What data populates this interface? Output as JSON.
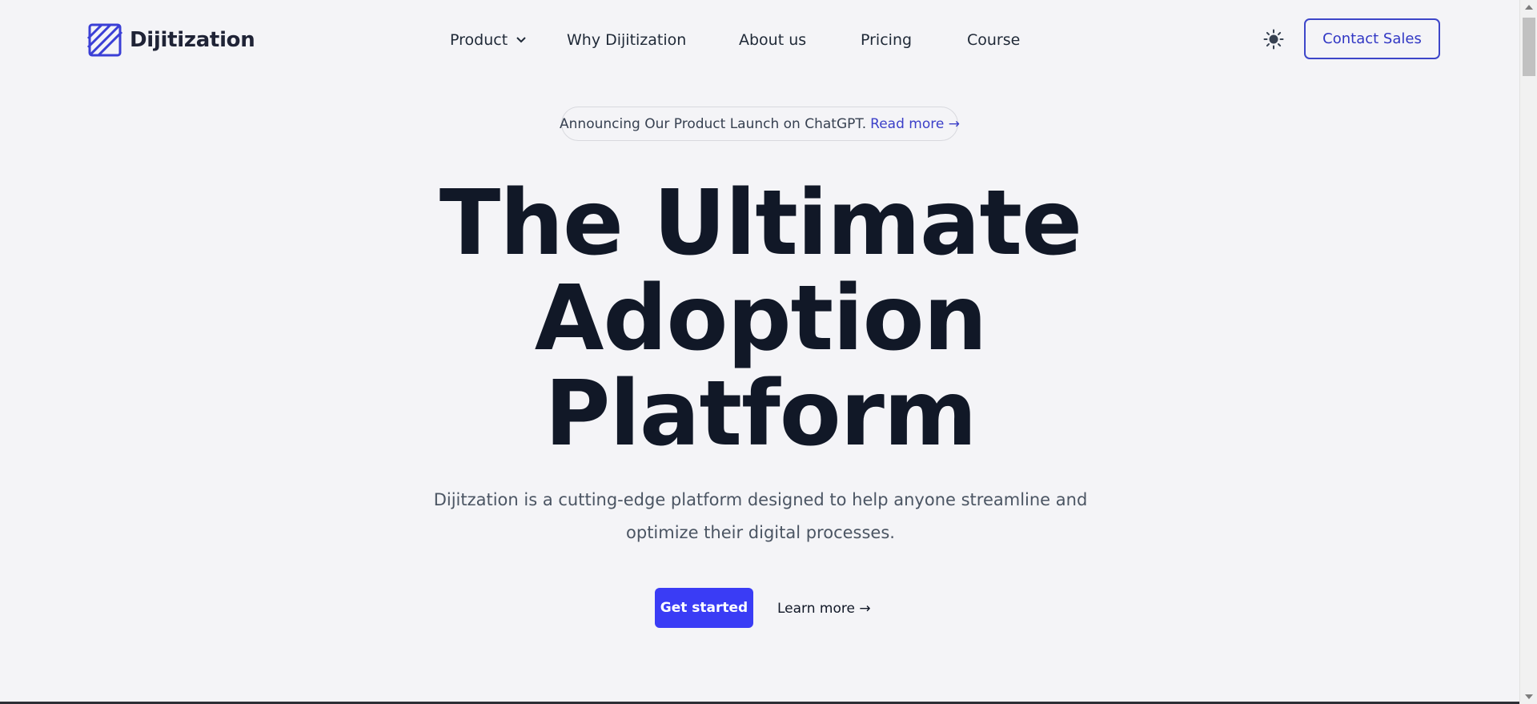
{
  "brand": {
    "name": "Dijitization",
    "logo_icon": "striped-square-logo",
    "accent_color": "#3a3cf5"
  },
  "nav": {
    "items": [
      {
        "label": "Product",
        "has_dropdown": true
      },
      {
        "label": "Why Dijitization"
      },
      {
        "label": "About us"
      },
      {
        "label": "Pricing"
      },
      {
        "label": "Course"
      }
    ],
    "theme_toggle_icon": "sun-icon",
    "contact_label": "Contact Sales"
  },
  "announcement": {
    "text": "Announcing Our Product Launch on ChatGPT.",
    "link_label": "Read more →"
  },
  "hero": {
    "title_lines": [
      "The Ultimate",
      "Adoption",
      "Platform"
    ],
    "subtitle": "Dijitzation is a cutting-edge platform designed to help anyone streamline and optimize their digital processes.",
    "primary_cta": "Get started",
    "secondary_cta": "Learn more →"
  }
}
